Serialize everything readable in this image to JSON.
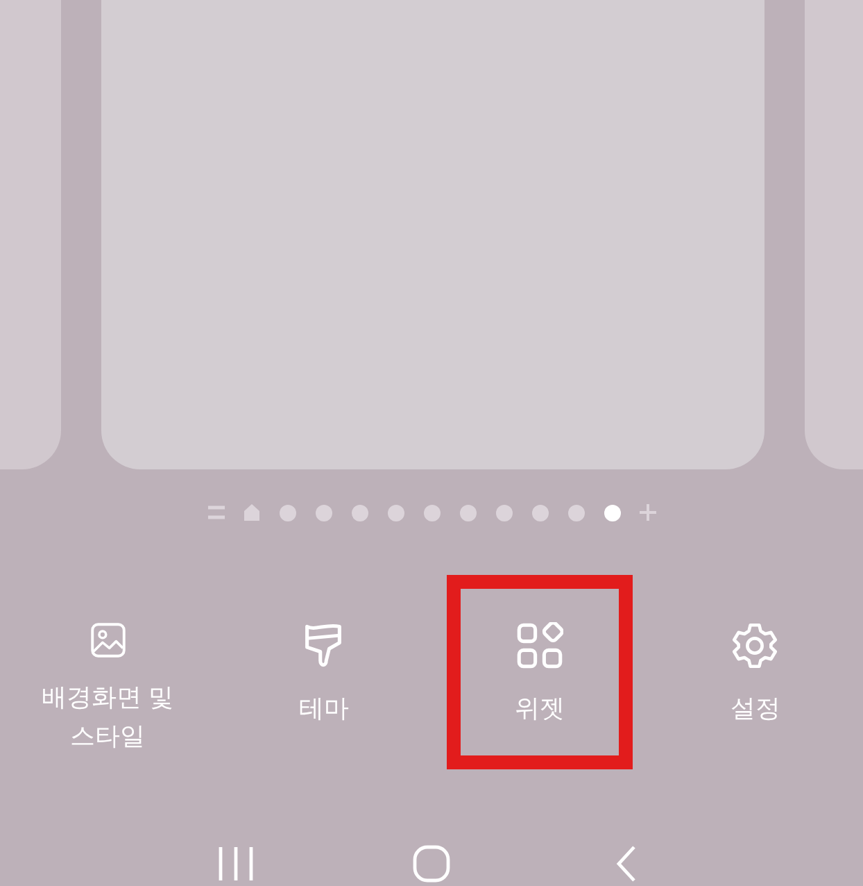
{
  "pages_indicator": [
    {
      "kind": "list",
      "selected": false
    },
    {
      "kind": "home",
      "selected": false
    },
    {
      "kind": "dot",
      "selected": false
    },
    {
      "kind": "dot",
      "selected": false
    },
    {
      "kind": "dot",
      "selected": false
    },
    {
      "kind": "dot",
      "selected": false
    },
    {
      "kind": "dot",
      "selected": false
    },
    {
      "kind": "dot",
      "selected": false
    },
    {
      "kind": "dot",
      "selected": false
    },
    {
      "kind": "dot",
      "selected": false
    },
    {
      "kind": "dot",
      "selected": false
    },
    {
      "kind": "dot",
      "selected": true
    },
    {
      "kind": "add",
      "selected": false
    }
  ],
  "menu": [
    {
      "kind": "wallpaper",
      "label": "배경화면 및\n스타일",
      "highlighted": false
    },
    {
      "kind": "theme",
      "label": "테마",
      "highlighted": false
    },
    {
      "kind": "widgets",
      "label": "위젯",
      "highlighted": true
    },
    {
      "kind": "settings",
      "label": "설정",
      "highlighted": false
    }
  ],
  "nav_bar": [
    {
      "kind": "recents"
    },
    {
      "kind": "home"
    },
    {
      "kind": "back"
    }
  ]
}
